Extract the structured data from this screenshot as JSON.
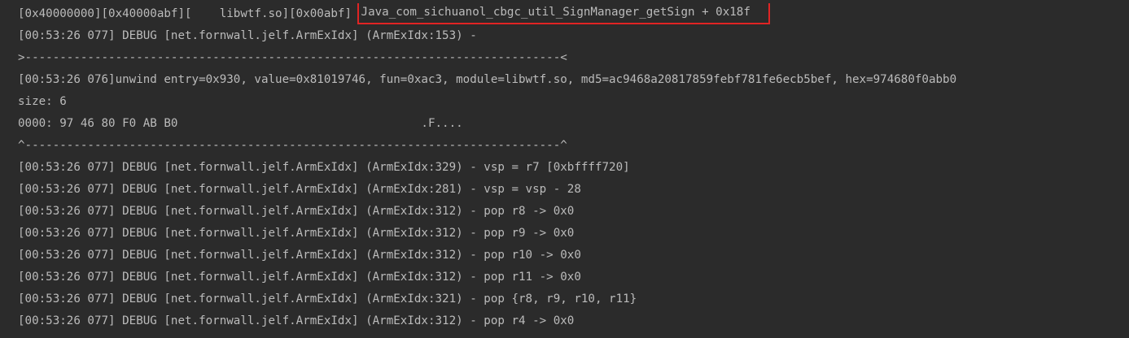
{
  "console": {
    "lines": [
      {
        "prefix": "[0x40000000][0x40000abf][    libwtf.so][0x00abf] ",
        "highlight": "Java_com_sichuanol_cbgc_util_SignManager_getSign + 0x18f"
      },
      {
        "text": "[00:53:26 077] DEBUG [net.fornwall.jelf.ArmExIdx] (ArmExIdx:153) -"
      },
      {
        "text": ">-----------------------------------------------------------------------------<"
      },
      {
        "text": "[00:53:26 076]unwind entry=0x930, value=0x81019746, fun=0xac3, module=libwtf.so, md5=ac9468a20817859febf781fe6ecb5bef, hex=974680f0abb0"
      },
      {
        "text": "size: 6"
      },
      {
        "text": "0000: 97 46 80 F0 AB B0                                   .F...."
      },
      {
        "text": "^-----------------------------------------------------------------------------^"
      },
      {
        "text": "[00:53:26 077] DEBUG [net.fornwall.jelf.ArmExIdx] (ArmExIdx:329) - vsp = r7 [0xbffff720]"
      },
      {
        "text": "[00:53:26 077] DEBUG [net.fornwall.jelf.ArmExIdx] (ArmExIdx:281) - vsp = vsp - 28"
      },
      {
        "text": "[00:53:26 077] DEBUG [net.fornwall.jelf.ArmExIdx] (ArmExIdx:312) - pop r8 -> 0x0"
      },
      {
        "text": "[00:53:26 077] DEBUG [net.fornwall.jelf.ArmExIdx] (ArmExIdx:312) - pop r9 -> 0x0"
      },
      {
        "text": "[00:53:26 077] DEBUG [net.fornwall.jelf.ArmExIdx] (ArmExIdx:312) - pop r10 -> 0x0"
      },
      {
        "text": "[00:53:26 077] DEBUG [net.fornwall.jelf.ArmExIdx] (ArmExIdx:312) - pop r11 -> 0x0"
      },
      {
        "text": "[00:53:26 077] DEBUG [net.fornwall.jelf.ArmExIdx] (ArmExIdx:321) - pop {r8, r9, r10, r11}"
      },
      {
        "text": "[00:53:26 077] DEBUG [net.fornwall.jelf.ArmExIdx] (ArmExIdx:312) - pop r4 -> 0x0"
      }
    ],
    "colors": {
      "background": "#2b2b2b",
      "text": "#bbbbbb",
      "highlight_border": "#e02424"
    }
  }
}
